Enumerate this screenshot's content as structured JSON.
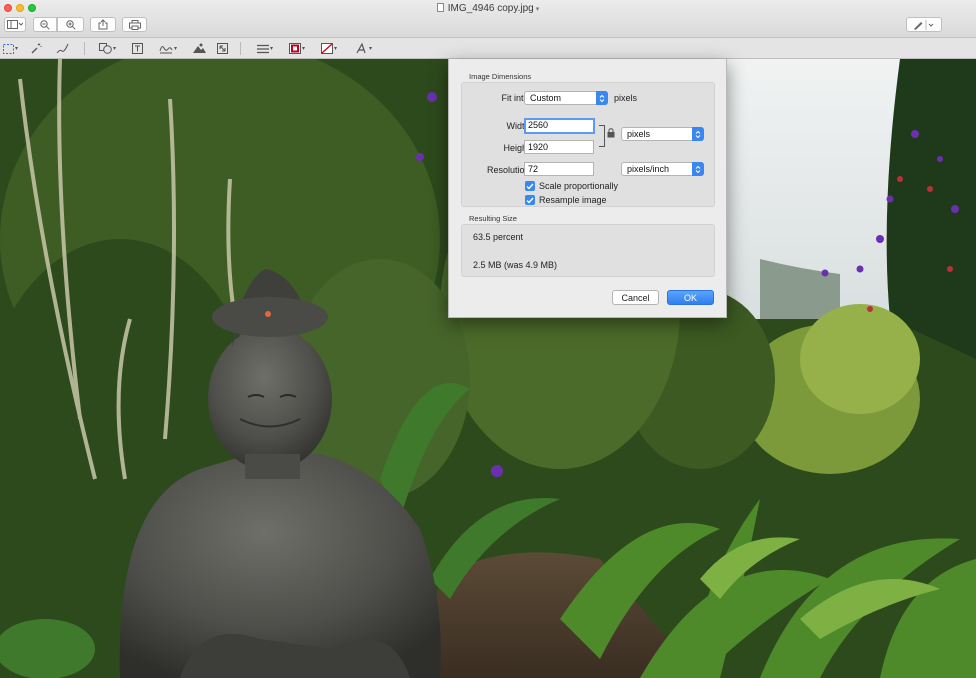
{
  "window": {
    "title": "IMG_4946 copy.jpg"
  },
  "toolbar": {
    "icons": [
      "sidebar-icon",
      "zoom-out-icon",
      "zoom-in-icon",
      "share-icon",
      "print-icon",
      "markup-pen-icon"
    ]
  },
  "markup_toolbar": {
    "icons": [
      "rectangular-selection-icon",
      "instant-alpha-icon",
      "sketch-icon",
      "shapes-icon",
      "text-icon",
      "sign-icon",
      "adjust-color-icon",
      "adjust-size-icon",
      "shape-style-icon",
      "border-color-icon",
      "fill-color-icon",
      "text-style-icon"
    ],
    "border_color": "#c0001c"
  },
  "dialog": {
    "dimensions_title": "Image Dimensions",
    "fit_into": {
      "label": "Fit into:",
      "value": "Custom",
      "unit": "pixels"
    },
    "width": {
      "label": "Width:",
      "value": "2560"
    },
    "height": {
      "label": "Height:",
      "value": "1920"
    },
    "dimension_unit": "pixels",
    "resolution": {
      "label": "Resolution:",
      "value": "72",
      "unit": "pixels/inch"
    },
    "scale_proportionally": {
      "label": "Scale proportionally",
      "checked": true
    },
    "resample_image": {
      "label": "Resample image",
      "checked": true
    },
    "resulting_title": "Resulting Size",
    "percent": "63.5 percent",
    "file_size": "2.5 MB (was 4.9 MB)",
    "cancel_label": "Cancel",
    "ok_label": "OK"
  },
  "colors": {
    "accent": "#3a87f0"
  }
}
